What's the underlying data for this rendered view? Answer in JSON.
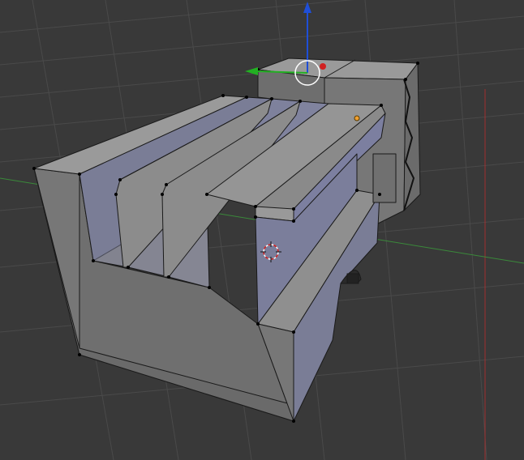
{
  "viewport": {
    "mode": "edit-mode",
    "shading": "solid",
    "background_color": "#393939",
    "grid_color": "#4a4a4a",
    "x_axis_color": "#c0392b",
    "y_axis_color": "#3aa33a",
    "z_gizmo_color": "#1f4fd8",
    "y_gizmo_color": "#22b022",
    "x_gizmo_color": "#d02020"
  },
  "mesh": {
    "object": "truck-body-mesh",
    "face_color_light": "#8f8f8f",
    "face_color_side": "#767676",
    "face_color_inner": "#7a7d96",
    "face_color_top": "#9a9a9a",
    "edge_color": "#1a1a1a",
    "vertex_color": "#000000"
  },
  "cursor_3d": {
    "icon": "3d-cursor-icon"
  },
  "gizmo": {
    "icon": "translate-manipulator-icon"
  },
  "selected_vertex_color": "#f0a030"
}
